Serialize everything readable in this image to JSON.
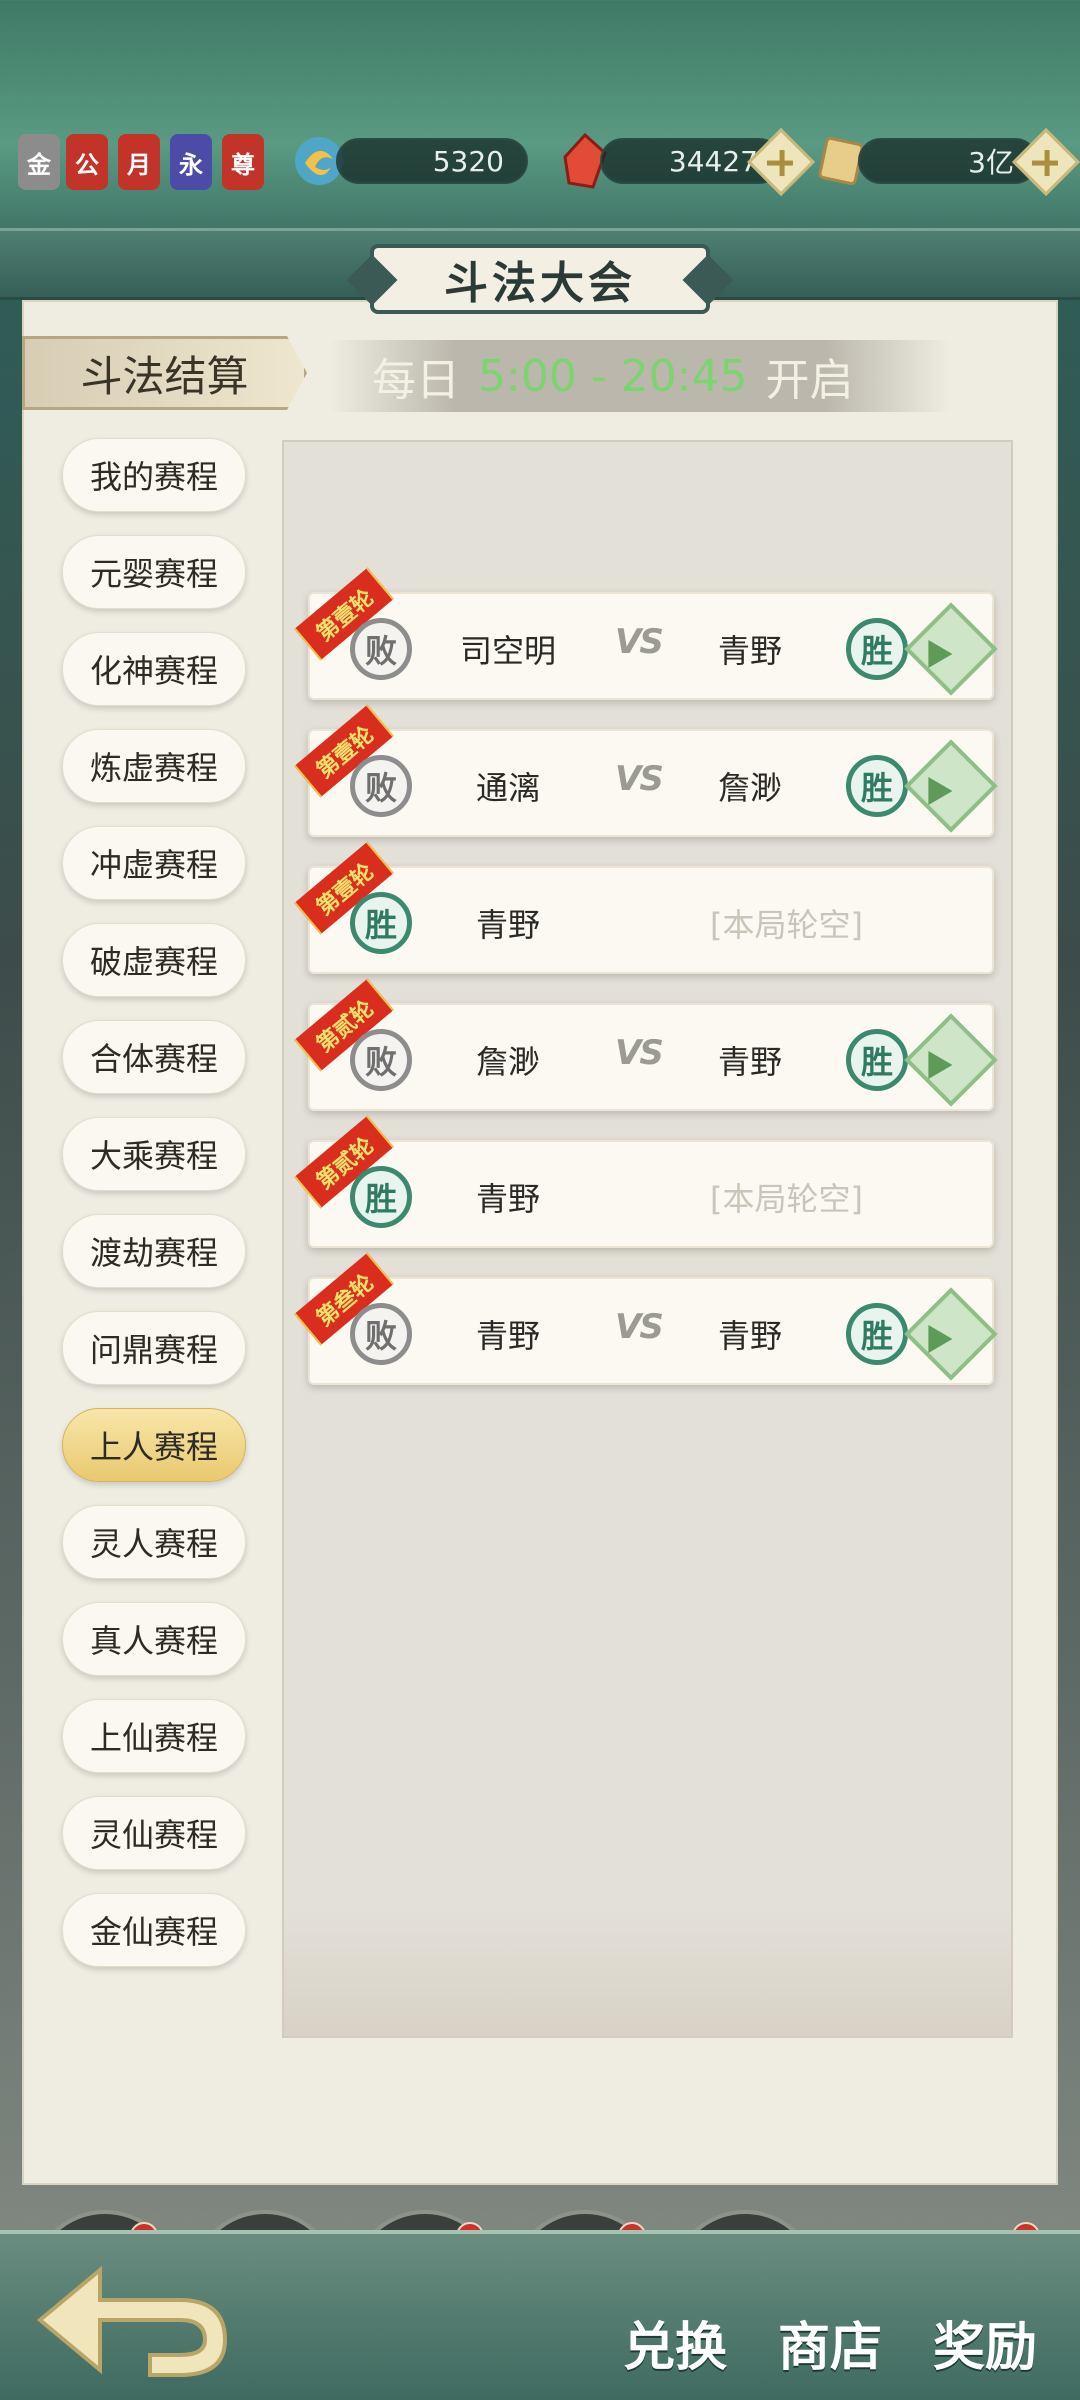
{
  "currency": {
    "badges": [
      "金",
      "公",
      "月",
      "永",
      "尊"
    ],
    "spirit_stones": "5320",
    "crystals": "34427",
    "scrolls": "3亿"
  },
  "header": {
    "title": "斗法大会"
  },
  "settle_tab": "斗法结算",
  "schedule": {
    "prefix": "每日",
    "time": "5:00 - 20:45",
    "suffix": "开启"
  },
  "sidebar": {
    "items": [
      {
        "label": "我的赛程",
        "active": false
      },
      {
        "label": "元婴赛程",
        "active": false
      },
      {
        "label": "化神赛程",
        "active": false
      },
      {
        "label": "炼虚赛程",
        "active": false
      },
      {
        "label": "冲虚赛程",
        "active": false
      },
      {
        "label": "破虚赛程",
        "active": false
      },
      {
        "label": "合体赛程",
        "active": false
      },
      {
        "label": "大乘赛程",
        "active": false
      },
      {
        "label": "渡劫赛程",
        "active": false
      },
      {
        "label": "问鼎赛程",
        "active": false
      },
      {
        "label": "上人赛程",
        "active": true
      },
      {
        "label": "灵人赛程",
        "active": false
      },
      {
        "label": "真人赛程",
        "active": false
      },
      {
        "label": "上仙赛程",
        "active": false
      },
      {
        "label": "灵仙赛程",
        "active": false
      },
      {
        "label": "金仙赛程",
        "active": false
      }
    ]
  },
  "matches": [
    {
      "round": "第壹轮",
      "left_result": "败",
      "left_name": "司空明",
      "vs": "VS",
      "right_name": "青野",
      "right_result": "胜",
      "bye": ""
    },
    {
      "round": "第壹轮",
      "left_result": "败",
      "left_name": "通漓",
      "vs": "VS",
      "right_name": "詹渺",
      "right_result": "胜",
      "bye": ""
    },
    {
      "round": "第壹轮",
      "left_result": "胜",
      "left_name": "青野",
      "vs": "",
      "right_name": "",
      "right_result": "",
      "bye": "[本局轮空]"
    },
    {
      "round": "第贰轮",
      "left_result": "败",
      "left_name": "詹渺",
      "vs": "VS",
      "right_name": "青野",
      "right_result": "胜",
      "bye": ""
    },
    {
      "round": "第贰轮",
      "left_result": "胜",
      "left_name": "青野",
      "vs": "",
      "right_name": "",
      "right_result": "",
      "bye": "[本局轮空]"
    },
    {
      "round": "第叁轮",
      "left_result": "败",
      "left_name": "青野",
      "vs": "VS",
      "right_name": "青野",
      "right_result": "胜",
      "bye": ""
    }
  ],
  "bottom": {
    "exchange": "兑换",
    "shop": "商店",
    "rewards": "奖励"
  }
}
